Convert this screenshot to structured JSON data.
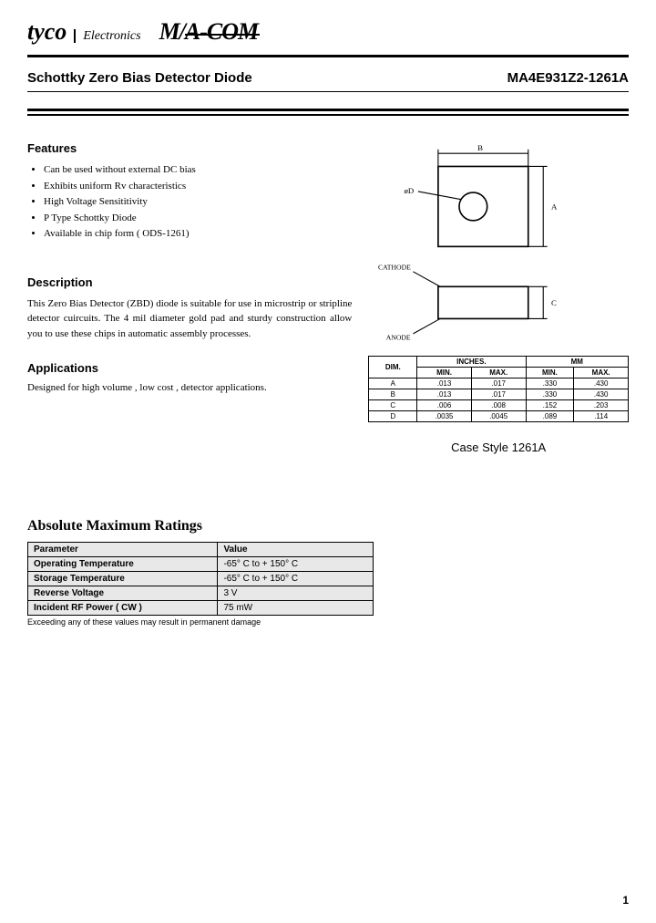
{
  "header": {
    "brand1": "tyco",
    "brand1_sub": "Electronics",
    "brand2_pre": "M/",
    "brand2_post": "A-COM"
  },
  "title": {
    "product_type": "Schottky Zero Bias Detector Diode",
    "part_number": "MA4E931Z2-1261A"
  },
  "features": {
    "heading": "Features",
    "items": [
      "Can be used without external DC bias",
      "Exhibits uniform Rv characteristics",
      "High Voltage Sensititivity",
      "P Type Schottky Diode",
      "Available in chip form ( ODS-1261)"
    ]
  },
  "description": {
    "heading": "Description",
    "text": "This Zero Bias Detector (ZBD) diode is suitable for use in microstrip or stripline detector cuircuits.  The 4 mil diameter gold pad and sturdy construction allow you to use these chips in automatic assembly processes."
  },
  "applications": {
    "heading": "Applications",
    "text": "Designed for high volume , low cost , detector applications."
  },
  "diagram": {
    "dim_b": "B",
    "dim_a": "A",
    "dim_c": "C",
    "dim_d": "øD",
    "cathode": "CATHODE",
    "anode": "ANODE"
  },
  "dim_table": {
    "h_dim": "DIM.",
    "h_inches": "INCHES.",
    "h_mm": "MM",
    "h_min": "MIN.",
    "h_max": "MAX.",
    "rows": [
      {
        "dim": "A",
        "in_min": ".013",
        "in_max": ".017",
        "mm_min": ".330",
        "mm_max": ".430"
      },
      {
        "dim": "B",
        "in_min": ".013",
        "in_max": ".017",
        "mm_min": ".330",
        "mm_max": ".430"
      },
      {
        "dim": "C",
        "in_min": ".006",
        "in_max": ".008",
        "mm_min": ".152",
        "mm_max": ".203"
      },
      {
        "dim": "D",
        "in_min": ".0035",
        "in_max": ".0045",
        "mm_min": ".089",
        "mm_max": ".114"
      }
    ]
  },
  "case_style": "Case Style 1261A",
  "amr": {
    "heading": "Absolute Maximum Ratings",
    "h_param": "Parameter",
    "h_value": "Value",
    "rows": [
      {
        "param": "Operating Temperature",
        "value": "-65° C to + 150° C"
      },
      {
        "param": "Storage Temperature",
        "value": "-65° C to + 150° C"
      },
      {
        "param": "Reverse Voltage",
        "value": "3 V"
      },
      {
        "param": "Incident RF Power ( CW )",
        "value": "75 mW"
      }
    ],
    "note": "Exceeding any of these values may result in permanent damage"
  },
  "page_number": "1"
}
